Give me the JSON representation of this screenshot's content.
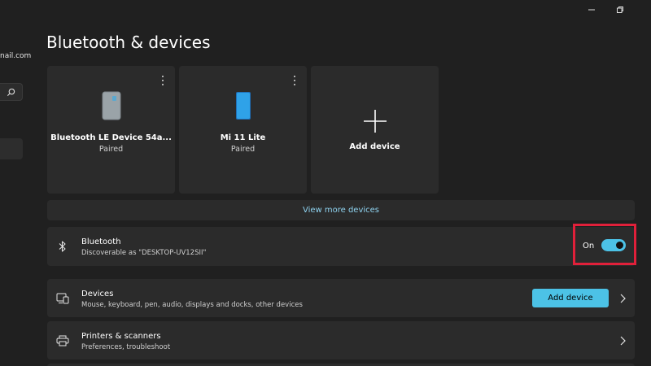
{
  "nav": {
    "email_fragment": "nail.com"
  },
  "header": {
    "title": "Bluetooth & devices"
  },
  "devices": [
    {
      "name": "Bluetooth LE Device 54a...",
      "status": "Paired",
      "icon": "speaker-icon"
    },
    {
      "name": "Mi 11 Lite",
      "status": "Paired",
      "icon": "phone-icon"
    }
  ],
  "add_card": {
    "label": "Add device",
    "icon": "plus-icon"
  },
  "view_more": {
    "label": "View more devices"
  },
  "bluetooth": {
    "title": "Bluetooth",
    "subtitle": "Discoverable as \"DESKTOP-UV12SII\"",
    "toggle_label": "On",
    "enabled": true
  },
  "devices_setting": {
    "title": "Devices",
    "subtitle": "Mouse, keyboard, pen, audio, displays and docks, other devices",
    "button_label": "Add device"
  },
  "printers_setting": {
    "title": "Printers & scanners",
    "subtitle": "Preferences, troubleshoot"
  },
  "colors": {
    "accent": "#4cc2e6",
    "background": "#202020",
    "card": "#2b2b2b",
    "highlight": "#e0203a"
  }
}
